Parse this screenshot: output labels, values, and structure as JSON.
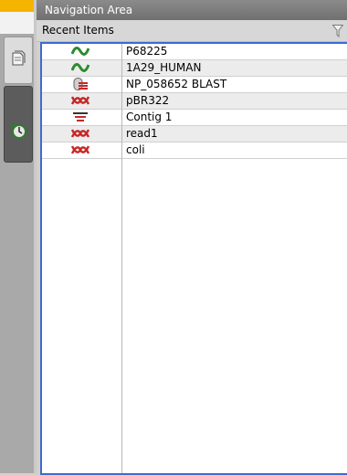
{
  "panel": {
    "title": "Navigation Area",
    "recent_header": "Recent Items"
  },
  "side_tabs": [
    {
      "icon": "open-document-icon"
    },
    {
      "icon": "history-icon"
    }
  ],
  "items": [
    {
      "name": "P68225",
      "icon": "protein-sequence-icon"
    },
    {
      "name": "1A29_HUMAN",
      "icon": "protein-sequence-icon"
    },
    {
      "name": "NP_058652 BLAST",
      "icon": "blast-database-icon"
    },
    {
      "name": "pBR322",
      "icon": "nucleotide-sequence-icon"
    },
    {
      "name": "Contig 1",
      "icon": "contig-icon"
    },
    {
      "name": "read1",
      "icon": "nucleotide-sequence-icon"
    },
    {
      "name": "coli",
      "icon": "nucleotide-sequence-icon"
    }
  ],
  "colors": {
    "title_bar": "#7a7a7a",
    "accent_orange": "#f5b400",
    "selection_border": "#3c6bd1",
    "protein_icon": "#2e8b2e",
    "nucleotide_icon": "#c62828"
  }
}
